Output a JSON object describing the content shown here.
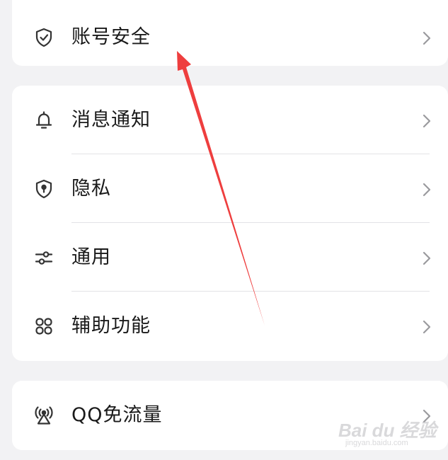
{
  "settings": {
    "account_security": {
      "label": "账号安全",
      "icon": "shield-check-icon"
    },
    "notifications": {
      "label": "消息通知",
      "icon": "bell-icon"
    },
    "privacy": {
      "label": "隐私",
      "icon": "shield-lock-icon"
    },
    "general": {
      "label": "通用",
      "icon": "sliders-icon"
    },
    "accessibility": {
      "label": "辅助功能",
      "icon": "grid-four-icon"
    },
    "qq_data_free": {
      "label": "QQ免流量",
      "icon": "signal-tower-icon"
    }
  },
  "annotation": {
    "color": "#ee3e3e",
    "icon": "red-arrow-pointer"
  },
  "watermark": {
    "main": "Bai du 经验",
    "sub": "jingyan.baidu.com"
  },
  "colors": {
    "background": "#f2f2f4",
    "card": "#ffffff",
    "text": "#1a1a1a",
    "icon": "#333333",
    "chevron": "#9a9a9e"
  }
}
